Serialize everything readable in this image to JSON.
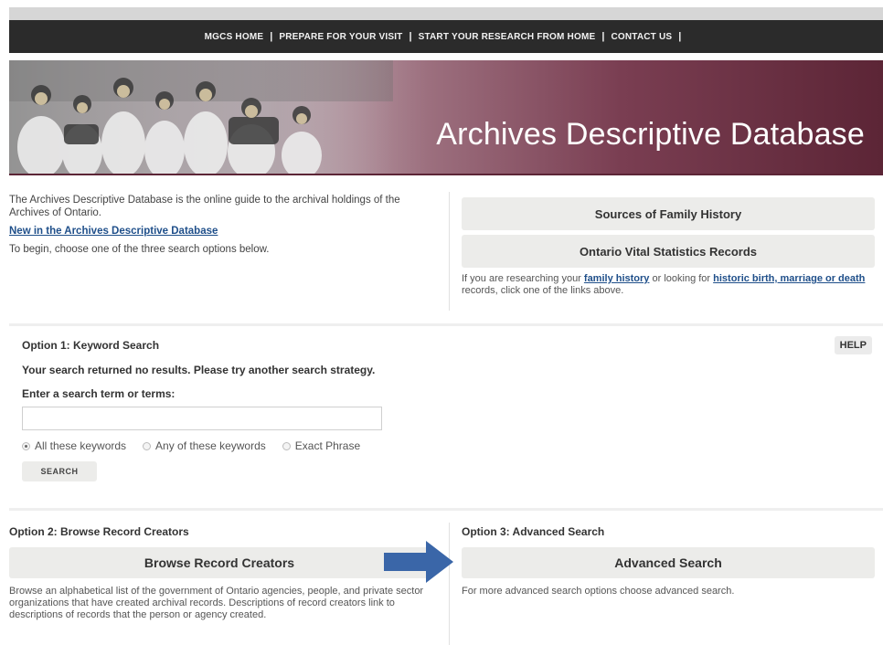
{
  "nav": {
    "items": [
      "MGCS HOME",
      "PREPARE FOR YOUR VISIT",
      "START YOUR RESEARCH FROM HOME",
      "CONTACT US"
    ],
    "separator": "|"
  },
  "banner": {
    "title": "Archives Descriptive Database"
  },
  "intro": {
    "description": "The Archives Descriptive Database is the online guide to the archival holdings of the Archives of Ontario.",
    "new_link": "New in the Archives Descriptive Database",
    "instruction": "To begin, choose one of the three search options below."
  },
  "family": {
    "sources_button": "Sources of Family History",
    "vital_button": "Ontario Vital Statistics Records",
    "note_prefix": "If you are researching your ",
    "note_link1": "family history",
    "note_middle": " or looking for ",
    "note_link2": "historic birth, marriage or death",
    "note_suffix": " records, click one of the links above."
  },
  "option1": {
    "title": "Option 1: Keyword Search",
    "help": "HELP",
    "no_results": "Your search returned no results. Please try another search strategy.",
    "input_label": "Enter a search term or terms:",
    "input_value": "",
    "radios": [
      {
        "label": "All these keywords",
        "selected": true
      },
      {
        "label": "Any of these keywords",
        "selected": false
      },
      {
        "label": "Exact Phrase",
        "selected": false
      }
    ],
    "search_button": "SEARCH"
  },
  "option2": {
    "title": "Option 2: Browse Record Creators",
    "button": "Browse Record Creators",
    "description": "Browse an alphabetical list of the government of Ontario agencies, people, and private sector organizations that have created archival records. Descriptions of record creators link to descriptions of records that the person or agency created."
  },
  "option3": {
    "title": "Option 3: Advanced Search",
    "button": "Advanced Search",
    "description": "For more advanced search options choose advanced search."
  },
  "colors": {
    "navbar": "#2b2b2b",
    "banner_dark": "#5c2536",
    "link": "#1f4f8a",
    "button_bg": "#ececea",
    "arrow": "#3a66a8"
  }
}
